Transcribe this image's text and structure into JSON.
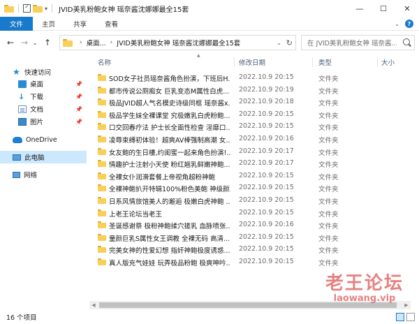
{
  "window": {
    "title": "JVID美乳粉鲍女神 瑶奈酱沈娜娜最全15套",
    "controls": {
      "minimize": "—",
      "maximize": "☐",
      "close": "✕"
    }
  },
  "ribbon": {
    "tabs": [
      "文件",
      "主页",
      "共享",
      "查看"
    ]
  },
  "nav": {
    "back": "←",
    "forward": "→",
    "recent": "⌄",
    "up": "↑",
    "breadcrumb": [
      "桌面...",
      "JVID美乳粉鲍女神 瑶奈酱沈娜娜最全15套"
    ],
    "search_placeholder": "在 JVID美乳粉鲍女神 瑶奈酱..."
  },
  "sidebar": {
    "items": [
      {
        "label": "快速访问",
        "icon": "star-icon"
      },
      {
        "label": "桌面",
        "icon": "desktop-icon",
        "pinned": true
      },
      {
        "label": "下载",
        "icon": "download-icon",
        "pinned": true
      },
      {
        "label": "文档",
        "icon": "documents-icon",
        "pinned": true
      },
      {
        "label": "图片",
        "icon": "pictures-icon",
        "pinned": true
      },
      {
        "label": "OneDrive",
        "icon": "cloud-icon"
      },
      {
        "label": "此电脑",
        "icon": "computer-icon",
        "selected": true
      },
      {
        "label": "网络",
        "icon": "network-icon"
      }
    ]
  },
  "columns": {
    "name": "名称",
    "date": "修改日期",
    "type": "类型",
    "size": "大小"
  },
  "files": [
    {
      "name": "SOD女子社员瑶奈酱角色扮演，下班后H...",
      "date": "2022.10.9 20:15",
      "type": "文件夹"
    },
    {
      "name": "都市传说公厕痴女 巨乳变态M属性白虎...",
      "date": "2022.10.9 20:19",
      "type": "文件夹"
    },
    {
      "name": "极品JVID超人气名模史诗级同框 瑶奈酱x...",
      "date": "2022.10.9 20:18",
      "type": "文件夹"
    },
    {
      "name": "极品学生妹全裸课堂 究极嫩乳白虎粉鲍...",
      "date": "2022.10.9 20:15",
      "type": "文件夹"
    },
    {
      "name": "口交回春疗法 护士长全面性检查 淫靡口...",
      "date": "2022.10.9 20:15",
      "type": "文件夹"
    },
    {
      "name": "凌辱束缚初体验！超爽AV棒强制高潮 女...",
      "date": "2022.10.9 20:16",
      "type": "文件夹"
    },
    {
      "name": "女友鲍的生日樓,约闺蜜一起来角色扮演!...",
      "date": "2022.10.9 20:17",
      "type": "文件夹"
    },
    {
      "name": "情趣护士注射小天使 粉红翘乳鲜嫩神鲍...",
      "date": "2022.10.9 20:17",
      "type": "文件夹"
    },
    {
      "name": "全裸女仆润滑套餐上帝视角超粉神鲍",
      "date": "2022.10.9 20:15",
      "type": "文件夹"
    },
    {
      "name": "全裸神鲍扒开特辑100%粉色美鲍 神级颜...",
      "date": "2022.10.9 20:15",
      "type": "文件夹"
    },
    {
      "name": "日系风情旅馆美人的邂逅 极嫩白虎神鲍 ...",
      "date": "2022.10.9 20:15",
      "type": "文件夹"
    },
    {
      "name": "上老王论坛当老王",
      "date": "2022.10.9 20:15",
      "type": "文件夹"
    },
    {
      "name": "圣诞感谢祭 极粉神鲍揉穴搓乳 血脉喷张...",
      "date": "2022.10.9 20:16",
      "type": "文件夹"
    },
    {
      "name": "童颜巨乳S属性女王调教 全裸无码 高清...",
      "date": "2022.10.9 20:15",
      "type": "文件夹"
    },
    {
      "name": "完美女神的性爱幻想 指奸神鲍极度诱惑...",
      "date": "2022.10.9 20:15",
      "type": "文件夹"
    },
    {
      "name": "真人版充气娃娃 玩弄极品粉鲍 极爽呻吟...",
      "date": "2022.10.9 20:15",
      "type": "文件夹"
    }
  ],
  "status": {
    "count": "16 个项目"
  },
  "watermark": {
    "cn": "老王论坛",
    "en": "laowang.vip"
  },
  "colors": {
    "accent": "#1979ca",
    "selected": "#cce8ff",
    "folder": "#f8cf58"
  }
}
